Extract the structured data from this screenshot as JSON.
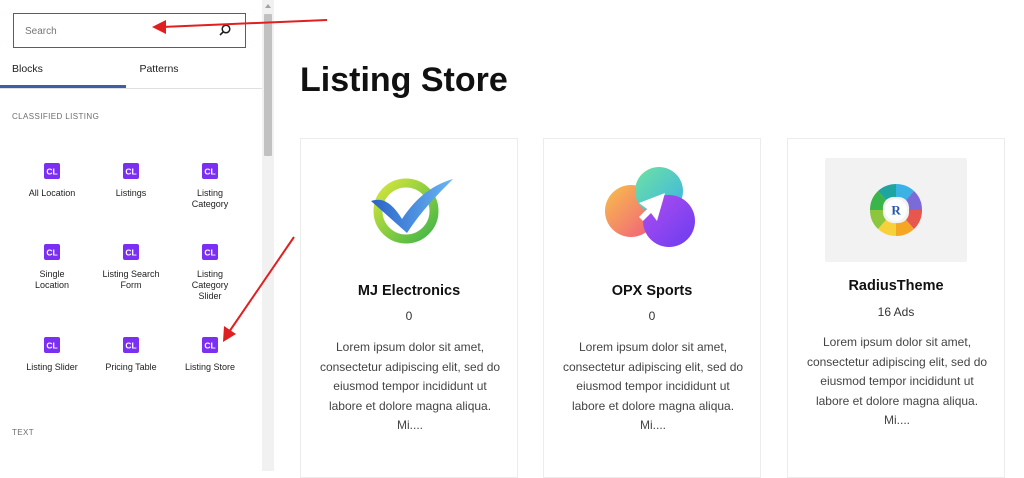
{
  "sidebar": {
    "search": {
      "placeholder": "Search",
      "value": ""
    },
    "tabs": [
      {
        "label": "Blocks"
      },
      {
        "label": "Patterns"
      }
    ],
    "sections": [
      {
        "title": "CLASSIFIED LISTING"
      },
      {
        "title": "TEXT"
      }
    ],
    "blocks": [
      {
        "label": "All Location",
        "icon": "classified-listing-icon"
      },
      {
        "label": "Listings",
        "icon": "classified-listing-icon"
      },
      {
        "label": "Listing Category",
        "icon": "classified-listing-icon"
      },
      {
        "label": "Single Location",
        "icon": "classified-listing-icon"
      },
      {
        "label": "Listing Search Form",
        "icon": "classified-listing-icon"
      },
      {
        "label": "Listing Category Slider",
        "icon": "classified-listing-icon"
      },
      {
        "label": "Listing Slider",
        "icon": "classified-listing-icon"
      },
      {
        "label": "Pricing Table",
        "icon": "classified-listing-icon"
      },
      {
        "label": "Listing Store",
        "icon": "classified-listing-icon"
      }
    ],
    "icon_text": "CL"
  },
  "main": {
    "title": "Listing Store",
    "stores": [
      {
        "name": "MJ Electronics",
        "count": "0",
        "description": "Lorem ipsum dolor sit amet, consectetur adipiscing elit, sed do eiusmod tempor incididunt ut labore et dolore magna aliqua. Mi....",
        "logo": "mj-electronics-logo"
      },
      {
        "name": "OPX Sports",
        "count": "0",
        "description": "Lorem ipsum dolor sit amet, consectetur adipiscing elit, sed do eiusmod tempor incididunt ut labore et dolore magna aliqua. Mi....",
        "logo": "opx-sports-logo"
      },
      {
        "name": "RadiusTheme",
        "count": "16 Ads",
        "description": "Lorem ipsum dolor sit amet, consectetur adipiscing elit, sed do eiusmod tempor incididunt ut labore et dolore magna aliqua. Mi....",
        "logo": "radiustheme-logo",
        "logo_letter": "R"
      }
    ]
  },
  "colors": {
    "accent": "#3e5fa7",
    "block_icon": "#7b2ff2",
    "annotation_arrow": "#e02020"
  }
}
